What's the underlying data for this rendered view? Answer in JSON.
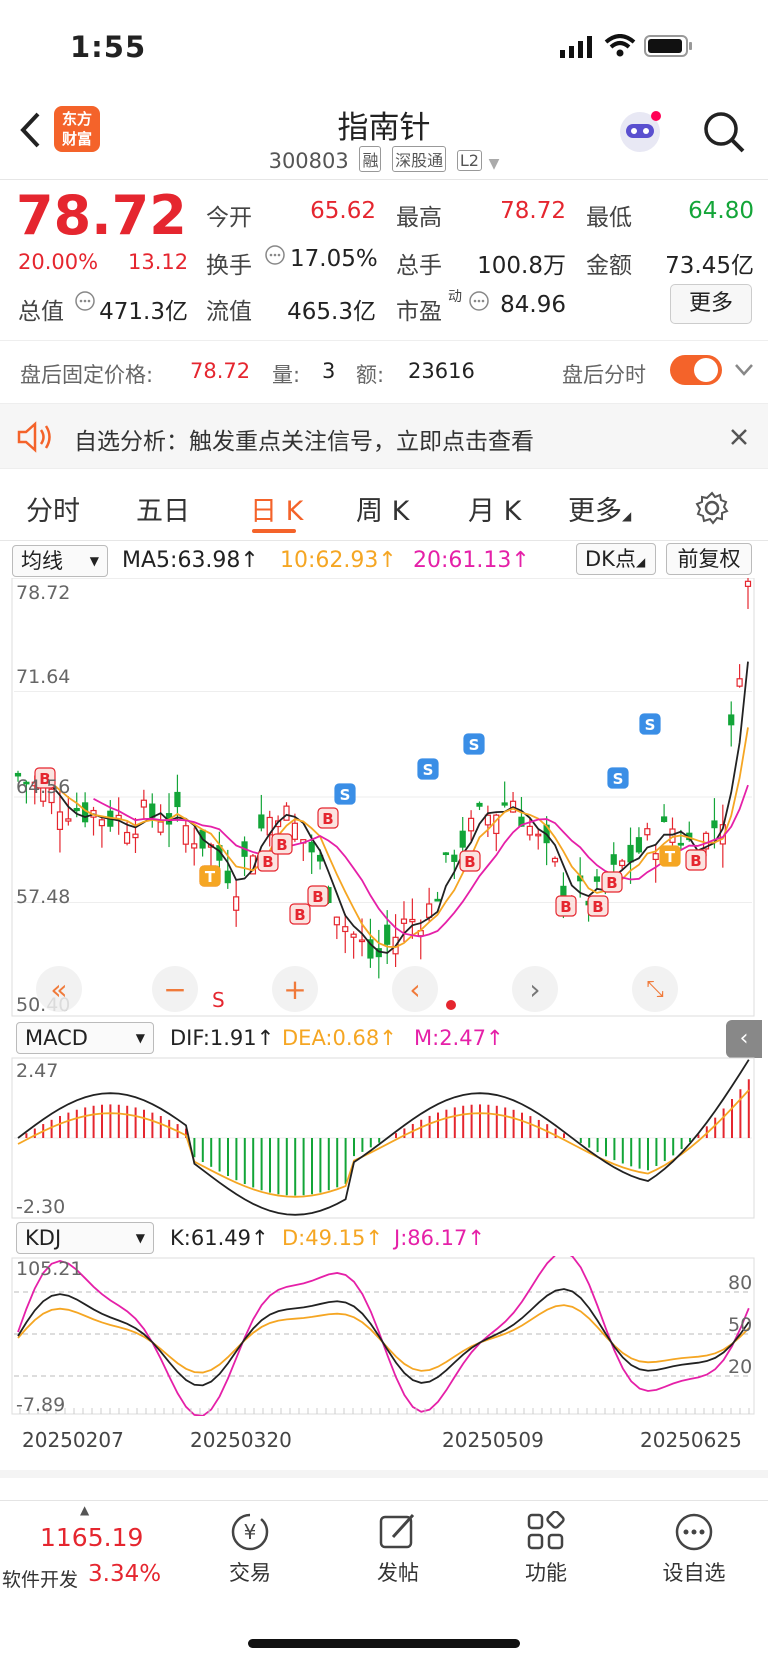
{
  "status_bar": {
    "time": "1:55"
  },
  "nav": {
    "title": "指南针",
    "code": "300803",
    "tags": [
      "融",
      "深股通",
      "L2"
    ],
    "logo_text": [
      "东方",
      "财富"
    ]
  },
  "quote": {
    "price": "78.72",
    "pct": "20.00%",
    "change": "13.12",
    "open_label": "今开",
    "open_value": "65.62",
    "high_label": "最高",
    "high_value": "78.72",
    "low_label": "最低",
    "low_value": "64.80",
    "turnover_label": "换手",
    "turnover_value": "17.05%",
    "volume_label": "总手",
    "volume_value": "100.8万",
    "amount_label": "金额",
    "amount_value": "73.45亿",
    "mktcap_label": "总值",
    "mktcap_value": "471.3亿",
    "float_label": "流值",
    "float_value": "465.3亿",
    "pe_label": "市盈",
    "pe_sup": "动",
    "pe_value": "84.96",
    "more_label": "更多"
  },
  "after_hours": {
    "price_label": "盘后固定价格:",
    "price_value": "78.72",
    "vol_label": "量:",
    "vol_value": "3",
    "amt_label": "额:",
    "amt_value": "23616",
    "toggle_label": "盘后分时",
    "toggle_on": true
  },
  "banner": {
    "text": "自选分析：触发重点关注信号，立即点击查看"
  },
  "tabs": [
    {
      "label": "分时"
    },
    {
      "label": "五日"
    },
    {
      "label": "日 K"
    },
    {
      "label": "周 K"
    },
    {
      "label": "月 K"
    },
    {
      "label": "更多"
    }
  ],
  "active_tab": "日 K",
  "kline": {
    "indicator_select": "均线",
    "ma5": "MA5:63.98",
    "ma10": "10:62.93",
    "ma20": "20:61.13",
    "dk_label": "DK点",
    "adjust_label": "前复权",
    "y_labels": [
      "78.72",
      "71.64",
      "64.56",
      "57.48",
      "50.40"
    ],
    "s_label": "S"
  },
  "macd": {
    "select": "MACD",
    "dif": "DIF:1.91",
    "dea": "DEA:0.68",
    "m": "M:2.47",
    "y_top": "2.47",
    "y_bottom": "-2.30"
  },
  "kdj": {
    "select": "KDJ",
    "k": "K:61.49",
    "d": "D:49.15",
    "j": "J:86.17",
    "y_top": "105.21",
    "y_bottom": "-7.89",
    "right_levels": [
      "80",
      "50",
      "20"
    ]
  },
  "x_dates": [
    "20250207",
    "20250320",
    "20250509",
    "20250625"
  ],
  "bottom_bar": {
    "index_value": "1165.19",
    "index_name": "软件开发",
    "index_pct": "3.34%",
    "items": [
      {
        "label": "交易"
      },
      {
        "label": "发帖"
      },
      {
        "label": "功能"
      },
      {
        "label": "设自选"
      }
    ]
  },
  "colors": {
    "up": "#e5262f",
    "down": "#13a538",
    "ma5": "#222222",
    "ma10": "#f5a623",
    "ma20": "#e520a8",
    "accent": "#f4632a"
  }
}
